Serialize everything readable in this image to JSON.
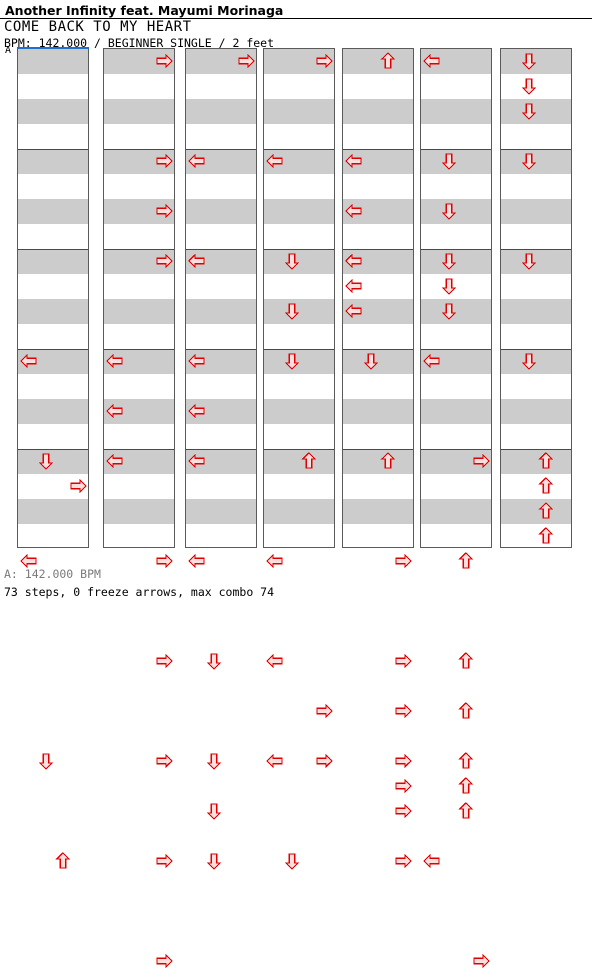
{
  "header": {
    "artist": "Another Infinity feat. Mayumi Morinaga",
    "title": "COME BACK TO MY HEART",
    "subtitle": "BPM: 142.000 / BEGINNER SINGLE / 2 feet",
    "difficulty_letter": "A"
  },
  "footer": {
    "bpm_line": "A: 142.000 BPM",
    "stats_line": "73 steps, 0 freeze arrows, max combo 74"
  },
  "colors": {
    "arrow_outline": "#dd0000",
    "arrow_fill": "#fbdede",
    "row_shade": "#cccccc",
    "row_plain": "#ffffff",
    "column_border": "#5a5a5a",
    "measure_line": "#4a4a4a",
    "top_marker": "#1f6fd0",
    "page_background": "#ffffff",
    "footer_bpm_text": "#7a7a7a"
  },
  "chart_data": {
    "type": "table",
    "title": "COME BACK TO MY HEART",
    "mode": "BEGINNER SINGLE",
    "feet": 2,
    "bpm": 142.0,
    "steps": 73,
    "freeze_arrows": 0,
    "max_combo": 74,
    "lanes": [
      "left",
      "down",
      "up",
      "right"
    ],
    "rows_per_measure": 4,
    "measures_per_column": 5,
    "columns": 7,
    "notes": [
      {
        "col": 0,
        "row": 12,
        "lanes": [
          "left"
        ]
      },
      {
        "col": 0,
        "row": 16,
        "lanes": [
          "down"
        ]
      },
      {
        "col": 0,
        "row": 17,
        "lanes": [
          "right"
        ]
      },
      {
        "col": 1,
        "row": 0,
        "lanes": [
          "right"
        ]
      },
      {
        "col": 1,
        "row": 4,
        "lanes": [
          "right"
        ]
      },
      {
        "col": 1,
        "row": 6,
        "lanes": [
          "right"
        ]
      },
      {
        "col": 1,
        "row": 8,
        "lanes": [
          "right"
        ]
      },
      {
        "col": 1,
        "row": 12,
        "lanes": [
          "left"
        ]
      },
      {
        "col": 1,
        "row": 14,
        "lanes": [
          "left"
        ]
      },
      {
        "col": 1,
        "row": 16,
        "lanes": [
          "left"
        ]
      },
      {
        "col": 2,
        "row": 0,
        "lanes": [
          "right"
        ]
      },
      {
        "col": 2,
        "row": 4,
        "lanes": [
          "left"
        ]
      },
      {
        "col": 2,
        "row": 8,
        "lanes": [
          "left"
        ]
      },
      {
        "col": 2,
        "row": 12,
        "lanes": [
          "left"
        ]
      },
      {
        "col": 2,
        "row": 14,
        "lanes": [
          "left"
        ]
      },
      {
        "col": 2,
        "row": 16,
        "lanes": [
          "left"
        ]
      },
      {
        "col": 3,
        "row": 0,
        "lanes": [
          "right"
        ]
      },
      {
        "col": 3,
        "row": 4,
        "lanes": [
          "left"
        ]
      },
      {
        "col": 3,
        "row": 8,
        "lanes": [
          "down"
        ]
      },
      {
        "col": 3,
        "row": 10,
        "lanes": [
          "down"
        ]
      },
      {
        "col": 3,
        "row": 12,
        "lanes": [
          "down"
        ]
      },
      {
        "col": 3,
        "row": 16,
        "lanes": [
          "up"
        ]
      },
      {
        "col": 4,
        "row": 0,
        "lanes": [
          "up"
        ]
      },
      {
        "col": 4,
        "row": 4,
        "lanes": [
          "left"
        ]
      },
      {
        "col": 4,
        "row": 6,
        "lanes": [
          "left"
        ]
      },
      {
        "col": 4,
        "row": 8,
        "lanes": [
          "left"
        ]
      },
      {
        "col": 4,
        "row": 9,
        "lanes": [
          "left"
        ]
      },
      {
        "col": 4,
        "row": 10,
        "lanes": [
          "left"
        ]
      },
      {
        "col": 4,
        "row": 12,
        "lanes": [
          "down"
        ]
      },
      {
        "col": 4,
        "row": 16,
        "lanes": [
          "up"
        ]
      },
      {
        "col": 5,
        "row": 0,
        "lanes": [
          "left"
        ]
      },
      {
        "col": 5,
        "row": 4,
        "lanes": [
          "down"
        ]
      },
      {
        "col": 5,
        "row": 6,
        "lanes": [
          "down"
        ]
      },
      {
        "col": 5,
        "row": 8,
        "lanes": [
          "down"
        ]
      },
      {
        "col": 5,
        "row": 9,
        "lanes": [
          "down"
        ]
      },
      {
        "col": 5,
        "row": 10,
        "lanes": [
          "down"
        ]
      },
      {
        "col": 5,
        "row": 12,
        "lanes": [
          "left"
        ]
      },
      {
        "col": 5,
        "row": 16,
        "lanes": [
          "right"
        ]
      },
      {
        "col": 6,
        "row": 0,
        "lanes": [
          "down"
        ]
      },
      {
        "col": 6,
        "row": 1,
        "lanes": [
          "down"
        ]
      },
      {
        "col": 6,
        "row": 2,
        "lanes": [
          "down"
        ]
      },
      {
        "col": 6,
        "row": 4,
        "lanes": [
          "down"
        ]
      },
      {
        "col": 6,
        "row": 8,
        "lanes": [
          "down"
        ]
      },
      {
        "col": 6,
        "row": 12,
        "lanes": [
          "down"
        ]
      },
      {
        "col": 6,
        "row": 16,
        "lanes": [
          "up"
        ]
      },
      {
        "col": 6,
        "row": 17,
        "lanes": [
          "up"
        ]
      },
      {
        "col": 6,
        "row": 18,
        "lanes": [
          "up"
        ]
      },
      {
        "col": 6,
        "row": 19,
        "lanes": [
          "up"
        ]
      },
      {
        "col": 0,
        "row": 20,
        "lanes": [
          "left"
        ]
      },
      {
        "col": 1,
        "row": 20,
        "lanes": [
          "right"
        ]
      },
      {
        "col": 2,
        "row": 20,
        "lanes": [
          "left"
        ]
      },
      {
        "col": 3,
        "row": 20,
        "lanes": [
          "left"
        ]
      },
      {
        "col": 4,
        "row": 20,
        "lanes": [
          "right"
        ]
      },
      {
        "col": 5,
        "row": 20,
        "lanes": [
          "up"
        ]
      },
      {
        "col": 1,
        "row": 24,
        "lanes": [
          "right"
        ]
      },
      {
        "col": 2,
        "row": 24,
        "lanes": [
          "down"
        ]
      },
      {
        "col": 3,
        "row": 24,
        "lanes": [
          "left"
        ]
      },
      {
        "col": 3,
        "row": 26,
        "lanes": [
          "right"
        ]
      },
      {
        "col": 4,
        "row": 24,
        "lanes": [
          "right"
        ]
      },
      {
        "col": 4,
        "row": 26,
        "lanes": [
          "right"
        ]
      },
      {
        "col": 5,
        "row": 24,
        "lanes": [
          "up"
        ]
      },
      {
        "col": 5,
        "row": 26,
        "lanes": [
          "up"
        ]
      },
      {
        "col": 0,
        "row": 28,
        "lanes": [
          "down"
        ]
      },
      {
        "col": 1,
        "row": 28,
        "lanes": [
          "right"
        ]
      },
      {
        "col": 2,
        "row": 28,
        "lanes": [
          "down"
        ]
      },
      {
        "col": 2,
        "row": 30,
        "lanes": [
          "down"
        ]
      },
      {
        "col": 3,
        "row": 28,
        "lanes": [
          "left",
          "right"
        ]
      },
      {
        "col": 4,
        "row": 28,
        "lanes": [
          "right"
        ]
      },
      {
        "col": 4,
        "row": 29,
        "lanes": [
          "right"
        ]
      },
      {
        "col": 4,
        "row": 30,
        "lanes": [
          "right"
        ]
      },
      {
        "col": 5,
        "row": 28,
        "lanes": [
          "up"
        ]
      },
      {
        "col": 5,
        "row": 29,
        "lanes": [
          "up"
        ]
      },
      {
        "col": 5,
        "row": 30,
        "lanes": [
          "up"
        ]
      },
      {
        "col": 0,
        "row": 32,
        "lanes": [
          "up"
        ]
      },
      {
        "col": 1,
        "row": 32,
        "lanes": [
          "right"
        ]
      },
      {
        "col": 2,
        "row": 32,
        "lanes": [
          "down"
        ]
      },
      {
        "col": 3,
        "row": 32,
        "lanes": [
          "down"
        ]
      },
      {
        "col": 4,
        "row": 32,
        "lanes": [
          "right"
        ]
      },
      {
        "col": 5,
        "row": 32,
        "lanes": [
          "left"
        ]
      },
      {
        "col": 1,
        "row": 36,
        "lanes": [
          "right"
        ]
      },
      {
        "col": 5,
        "row": 36,
        "lanes": [
          "right"
        ]
      }
    ]
  }
}
